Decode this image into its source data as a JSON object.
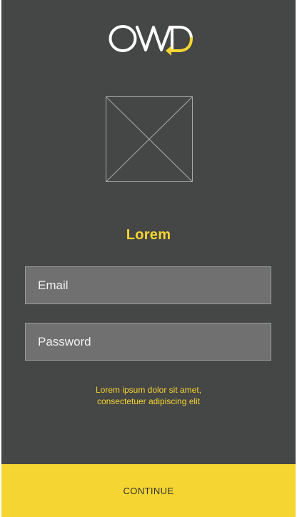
{
  "brand": {
    "logo_text": "OWD",
    "logo_icon": "return-arrow-icon",
    "accent_color": "#f5d531",
    "background_color": "#454646"
  },
  "hero": {
    "image_icon": "image-placeholder-icon"
  },
  "login": {
    "title": "Lorem",
    "email_placeholder": "Email",
    "email_value": "",
    "password_placeholder": "Password",
    "password_value": "",
    "hint_line1": "Lorem ipsum dolor sit amet,",
    "hint_line2": "consectetuer adipiscing elit",
    "continue_label": "CONTINUE"
  }
}
